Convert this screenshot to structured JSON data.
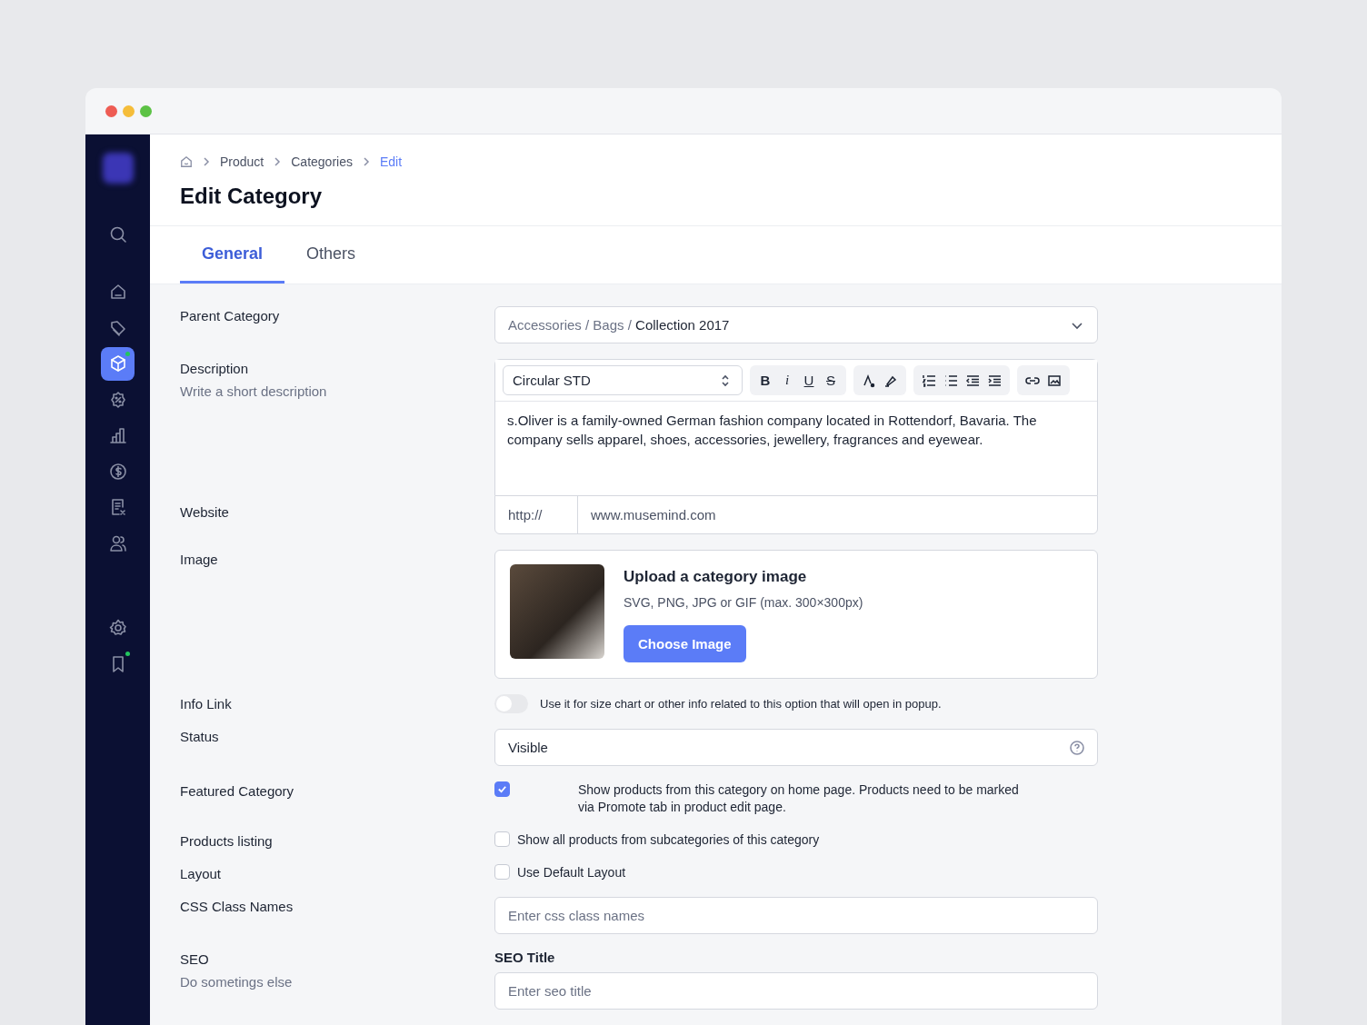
{
  "sidebar": {
    "items": [
      {
        "kind": "search",
        "selected": false,
        "dot": false
      },
      {
        "kind": "home",
        "selected": false,
        "dot": false
      },
      {
        "kind": "tag",
        "selected": false,
        "dot": false
      },
      {
        "kind": "box",
        "selected": true,
        "dot": true
      },
      {
        "kind": "discount",
        "selected": false,
        "dot": false
      },
      {
        "kind": "chart",
        "selected": false,
        "dot": false
      },
      {
        "kind": "dollar",
        "selected": false,
        "dot": false
      },
      {
        "kind": "receipt",
        "selected": false,
        "dot": false
      },
      {
        "kind": "users",
        "selected": false,
        "dot": false
      }
    ],
    "bottom_items": [
      {
        "kind": "settings",
        "selected": false,
        "dot": false
      },
      {
        "kind": "bookmark",
        "selected": false,
        "dot": true
      }
    ]
  },
  "breadcrumb": [
    {
      "label": "Product",
      "current": false
    },
    {
      "label": "Categories",
      "current": false
    },
    {
      "label": "Edit",
      "current": true
    }
  ],
  "title": "Edit Category",
  "tabs": [
    {
      "label": "General",
      "selected": true
    },
    {
      "label": "Others",
      "selected": false
    }
  ],
  "rows": [
    {
      "kind": "select",
      "label": "Parent Category",
      "path": "Accessories / Bags /",
      "value": "Collection 2017"
    },
    {
      "kind": "editor",
      "label": "Description",
      "sublabel": "Write a short description",
      "font": "Circular STD",
      "format_buttons": [
        {
          "label": "B",
          "kind": "bold"
        },
        {
          "label": "i",
          "kind": "italic"
        },
        {
          "label": "U",
          "kind": "underline"
        },
        {
          "label": "S",
          "kind": "strike"
        }
      ],
      "text": "s.Oliver is a family-owned German fashion company located in Rottendorf, Bavaria. The company sells apparel, shoes, accessories, jewellery, fragrances and eyewear."
    },
    {
      "kind": "url",
      "label": "Website",
      "prefix": "http://",
      "value": "www.musemind.com"
    },
    {
      "kind": "upload",
      "label": "Image",
      "title": "Upload a category image",
      "hint": "SVG, PNG, JPG or GIF (max. 300×300px)",
      "button": "Choose Image"
    },
    {
      "kind": "toggle",
      "label": "Info Link",
      "on": false,
      "text": "Use it for size chart or other info related to this option that will open in popup."
    },
    {
      "kind": "status",
      "label": "Status",
      "value": "Visible"
    },
    {
      "kind": "checkbox_note",
      "label": "Featured Category",
      "checked": true,
      "text": "Show products from this category on home page. Products need to be marked via Promote tab in product edit page."
    },
    {
      "kind": "checkbox",
      "label": "Products listing",
      "checked": false,
      "text": "Show all products from subcategories of this category"
    },
    {
      "kind": "checkbox",
      "label": "Layout",
      "checked": false,
      "text": "Use Default Layout"
    },
    {
      "kind": "input",
      "label": "CSS Class Names",
      "placeholder": "Enter css class names"
    },
    {
      "kind": "seo",
      "label": "SEO",
      "sublabel": "Do sometings else",
      "field_label": "SEO Title",
      "placeholder": "Enter seo title"
    }
  ]
}
